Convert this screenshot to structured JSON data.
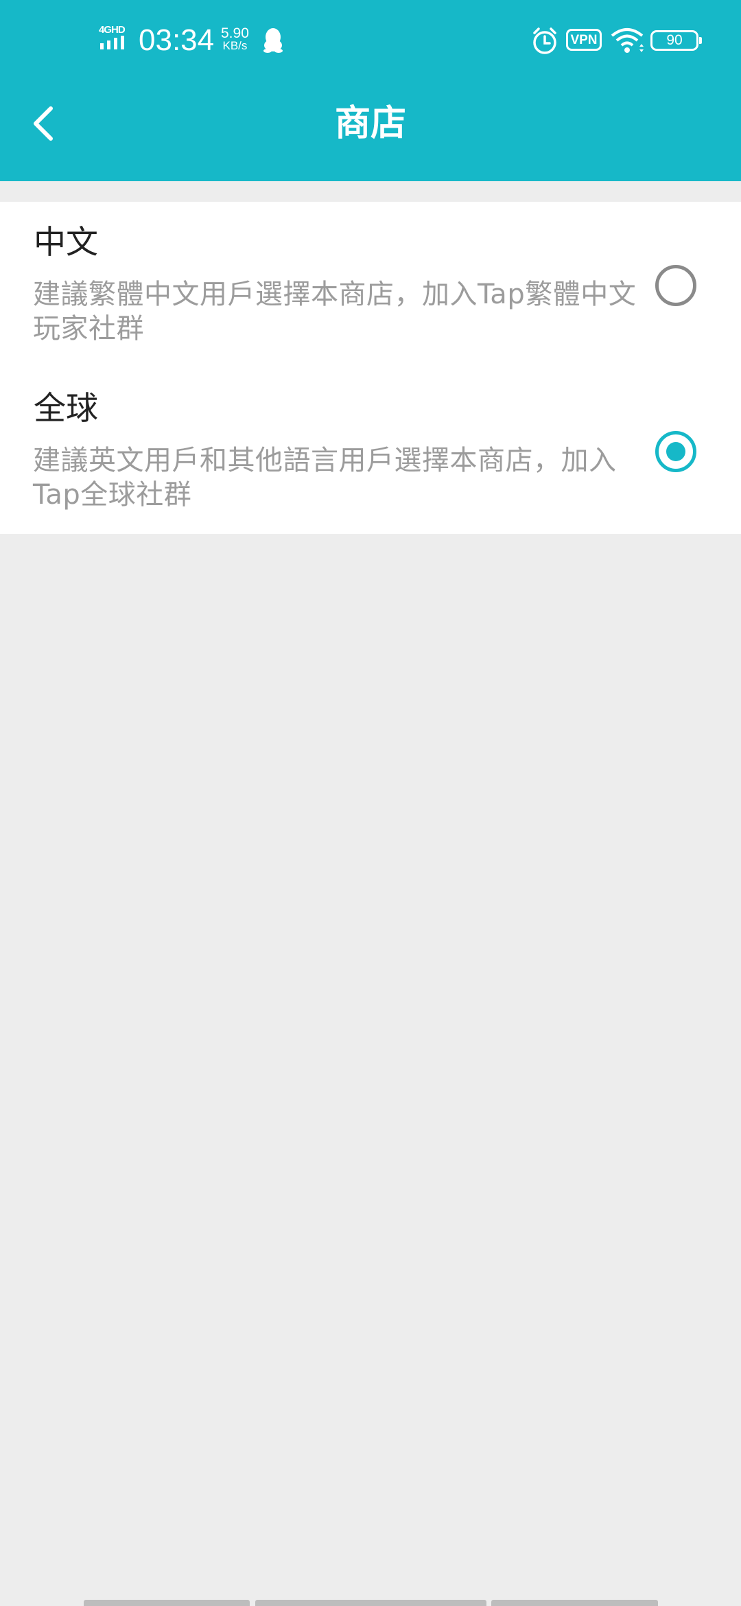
{
  "status_bar": {
    "network": "4GHD",
    "time": "03:34",
    "speed_value": "5.90",
    "speed_unit": "KB/s",
    "vpn": "VPN",
    "battery": "90"
  },
  "header": {
    "title": "商店",
    "back_icon": "chevron-left-icon"
  },
  "options": [
    {
      "title": "中文",
      "description": "建議繁體中文用戶選擇本商店，加入Tap繁體中文玩家社群",
      "selected": false
    },
    {
      "title": "全球",
      "description": "建議英文用戶和其他語言用戶選擇本商店，加入Tap全球社群",
      "selected": true
    }
  ],
  "colors": {
    "accent": "#16b8c8",
    "background": "#ededed",
    "title_text": "#222222",
    "secondary_text": "#9c9c9c"
  }
}
